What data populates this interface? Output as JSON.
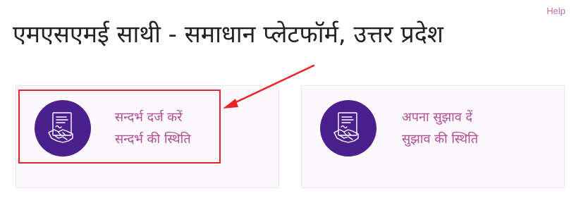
{
  "header": {
    "help_label": "Help",
    "title": "एमएसएमई साथी - समाधान प्लेटफॉर्म, उत्तर प्रदेश"
  },
  "cards": [
    {
      "icon": "handshake-document-icon",
      "link_primary": "सन्दर्भ दर्ज करें",
      "link_secondary": "सन्दर्भ की स्थिति"
    },
    {
      "icon": "handshake-document-icon",
      "link_primary": "अपना सुझाव दें",
      "link_secondary": "सुझाव की स्थिति"
    }
  ],
  "colors": {
    "accent_purple": "#4b1f8e",
    "link_pink": "#b24f93",
    "annotation_red": "#e8232b",
    "card_background": "#fdf8fd"
  }
}
